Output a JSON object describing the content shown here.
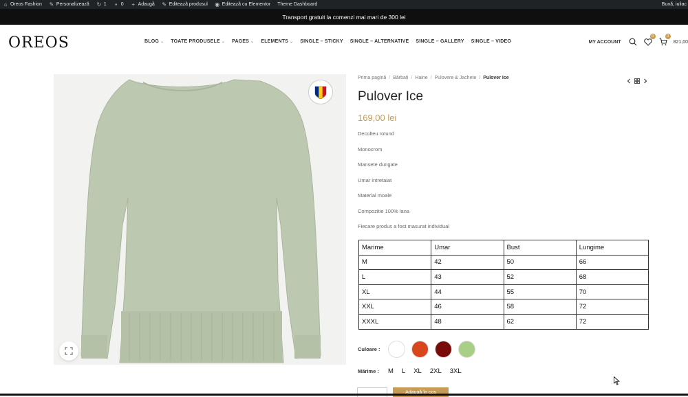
{
  "adminbar": {
    "items": [
      {
        "label": "Oreos Fashion",
        "icon": "site-icon"
      },
      {
        "label": "Personalizează",
        "icon": "brush-icon"
      },
      {
        "label": "1",
        "icon": "updates-icon"
      },
      {
        "label": "0",
        "icon": "comment-icon"
      },
      {
        "label": "Adaugă",
        "icon": "plus-icon"
      },
      {
        "label": "Editează produsul",
        "icon": "pencil-icon"
      },
      {
        "label": "Editează cu Elementor",
        "icon": "elementor-icon"
      },
      {
        "label": "Theme Dashboard",
        "icon": ""
      }
    ],
    "greeting": "Bună, iuliac"
  },
  "promo": {
    "text": "Transport gratuit la comenzi mai mari de 300 lei"
  },
  "header": {
    "logo": "OREOS",
    "nav": [
      "BLOG",
      "TOATE PRODUSELE",
      "PAGES",
      "ELEMENTS",
      "SINGLE – STICKY",
      "SINGLE – ALTERNATIVE",
      "SINGLE – GALLERY",
      "SINGLE – VIDEO"
    ],
    "account": "MY ACCOUNT",
    "wishlist_count": "0",
    "cart_count": "0",
    "cart_total": "821,00"
  },
  "breadcrumb": [
    "Prima pagină",
    "Bărbați",
    "Haine",
    "Pulovere & Jachete",
    "Pulover Ice"
  ],
  "product": {
    "title": "Pulover Ice",
    "price": "169,00 lei",
    "features": [
      "Decolteu rotund",
      "Monocrom",
      "Mansete dungate",
      "Umar intretaiat",
      "Material moale",
      "Compozitie 100% lana",
      "Fiecare produs a fost masurat individual"
    ]
  },
  "size_table": {
    "headers": [
      "Marime",
      "Umar",
      "Bust",
      "Lungime"
    ],
    "rows": [
      [
        "M",
        "42",
        "50",
        "66"
      ],
      [
        "L",
        "43",
        "52",
        "68"
      ],
      [
        "XL",
        "44",
        "55",
        "70"
      ],
      [
        "XXL",
        "46",
        "58",
        "72"
      ],
      [
        "XXXL",
        "48",
        "62",
        "72"
      ]
    ]
  },
  "color_label": "Culoare :",
  "colors": [
    "#ffffff",
    "#d9461b",
    "#7a0b0b",
    "#a8cf85"
  ],
  "size_label": "Mărime :",
  "sizes": [
    "M",
    "L",
    "XL",
    "2XL",
    "3XL"
  ],
  "add_to_cart": "Adaugă în coș",
  "theme": {
    "accent": "#c69b56",
    "sweater": "#bcc8b0"
  }
}
